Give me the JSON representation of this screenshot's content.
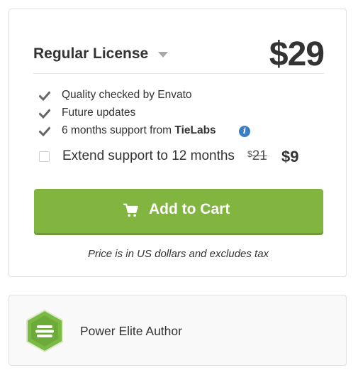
{
  "license": {
    "name": "Regular License",
    "price": "$29"
  },
  "features": [
    {
      "text": "Quality checked by Envato"
    },
    {
      "text": "Future updates"
    },
    {
      "text_prefix": "6 months support from ",
      "text_bold": "TieLabs"
    }
  ],
  "extend": {
    "label": "Extend support to 12 months",
    "old_currency": "$",
    "old_amount": "21",
    "new_price": "$9"
  },
  "cart": {
    "button_label": "Add to Cart"
  },
  "price_note": "Price is in US dollars and excludes tax",
  "author": {
    "label": "Power Elite Author"
  },
  "colors": {
    "accent_green": "#82b440",
    "badge_green": "#79b944",
    "info_blue": "#3a7fc1"
  }
}
